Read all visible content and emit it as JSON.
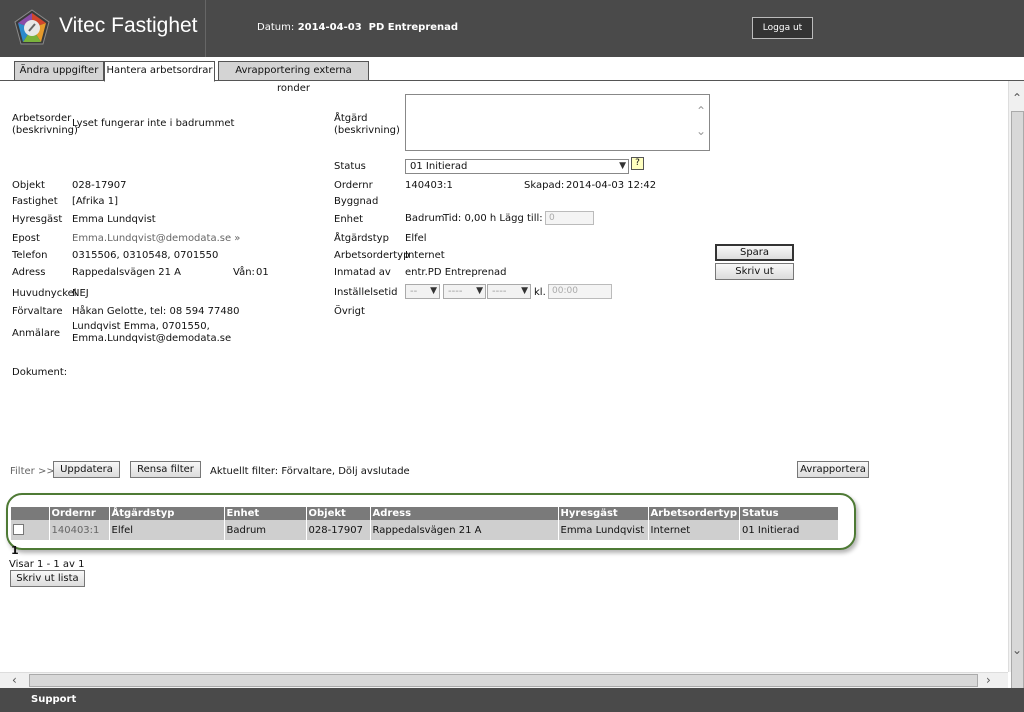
{
  "header": {
    "app_title": "Vitec Fastighet",
    "date_label": "Datum:",
    "date_value": "2014-04-03",
    "company": "PD Entreprenad",
    "logout_label": "Logga ut"
  },
  "tabs": [
    {
      "label": "Ändra uppgifter"
    },
    {
      "label": "Hantera arbetsordrar"
    },
    {
      "label": "Avrapportering externa ronder"
    }
  ],
  "left": {
    "arbetsorder_label": "Arbetsorder (beskrivning)",
    "arbetsorder_value": "Lyset fungerar inte i badrummet",
    "objekt_label": "Objekt",
    "objekt_value": "028-17907",
    "fastighet_label": "Fastighet",
    "fastighet_value": "[Afrika 1]",
    "hyresgast_label": "Hyresgäst",
    "hyresgast_value": "Emma Lundqvist",
    "epost_label": "Epost",
    "epost_value": "Emma.Lundqvist@demodata.se »",
    "telefon_label": "Telefon",
    "telefon_value": "0315506, 0310548, 0701550",
    "adress_label": "Adress",
    "adress_value": "Rappedalsvägen 21 A",
    "van_label": "Vån:",
    "van_value": "01",
    "huvudnyckel_label": "Huvudnyckel",
    "huvudnyckel_value": "NEJ",
    "forvaltare_label": "Förvaltare",
    "forvaltare_value": "Håkan Gelotte, tel: 08 594 77480",
    "anmalare_label": "Anmälare",
    "anmalare_line1": "Lundqvist Emma, 0701550,",
    "anmalare_line2": "Emma.Lundqvist@demodata.se",
    "dokument_label": "Dokument:"
  },
  "right": {
    "atgard_label": "Åtgärd (beskrivning)",
    "status_label": "Status",
    "status_value": "01 Initierad",
    "help_icon": "?",
    "ordernr_label": "Ordernr",
    "ordernr_value": "140403:1",
    "skapad_label": "Skapad:",
    "skapad_value": "2014-04-03 12:42",
    "byggnad_label": "Byggnad",
    "enhet_label": "Enhet",
    "enhet_value": "Badrum",
    "tid_label": "Tid: 0,00 h Lägg till:",
    "tid_input": "0",
    "atgardstyp_label": "Åtgärdstyp",
    "atgardstyp_value": "Elfel",
    "arbetsordertyp_label": "Arbetsordertyp",
    "arbetsordertyp_value": "Internet",
    "inmatad_label": "Inmatad av",
    "inmatad_value": "entr.PD Entreprenad",
    "installelsetid_label": "Inställelsetid",
    "sel1": "--",
    "sel2": "----",
    "sel3": "----",
    "kl_label": "kl.",
    "kl_value": "00:00",
    "ovrigt_label": "Övrigt",
    "spara_label": "Spara",
    "skrivut_label": "Skriv ut"
  },
  "filter": {
    "filter_label": "Filter >>",
    "update_label": "Uppdatera",
    "clear_label": "Rensa filter",
    "current_filter": "Aktuellt filter: Förvaltare, Dölj avslutade",
    "report_label": "Avrapportera"
  },
  "table": {
    "columns": [
      "",
      "Ordernr",
      "Åtgärdstyp",
      "Enhet",
      "Objekt",
      "Adress",
      "Hyresgäst",
      "Arbetsordertyp",
      "Status"
    ],
    "rows": [
      [
        "",
        "140403:1",
        "Elfel",
        "Badrum",
        "028-17907",
        "Rappedalsvägen 21 A",
        "Emma Lundqvist",
        "Internet",
        "01 Initierad"
      ]
    ]
  },
  "pager": {
    "page": "1",
    "showing": "Visar 1 - 1 av 1",
    "print_list_label": "Skriv ut lista"
  },
  "footer": {
    "support_label": "Support"
  },
  "colors": {
    "header_bg": "#4a4a4a",
    "table_border": "#4e7a35"
  }
}
